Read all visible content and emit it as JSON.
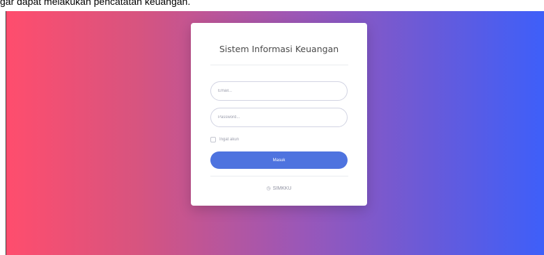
{
  "caption": "gar dapat melakukan pencatatan keuangan.",
  "colors": {
    "gradient_left": "#ff4d6d",
    "gradient_right": "#3e5ff9",
    "button": "#4e73df"
  },
  "login": {
    "title": "Sistem Informasi Keuangan",
    "email_placeholder": "Email...",
    "password_placeholder": "Password...",
    "remember_label": "Ingat akun",
    "submit_label": "Masuk",
    "brand_icon": "clock-icon",
    "brand_icon_glyph": "◷",
    "brand": "SIMKKU"
  }
}
